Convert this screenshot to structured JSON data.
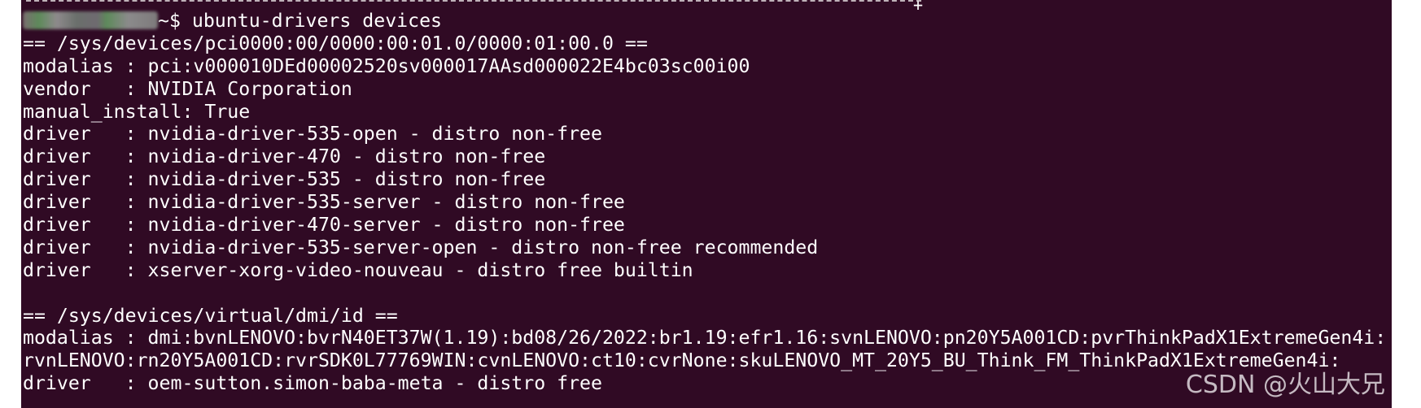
{
  "terminal": {
    "prompt_tail": "~$ ",
    "command": "ubuntu-drivers devices",
    "lines": [
      "== /sys/devices/pci0000:00/0000:00:01.0/0000:01:00.0 ==",
      "modalias : pci:v000010DEd00002520sv000017AAsd000022E4bc03sc00i00",
      "vendor   : NVIDIA Corporation",
      "manual_install: True",
      "driver   : nvidia-driver-535-open - distro non-free",
      "driver   : nvidia-driver-470 - distro non-free",
      "driver   : nvidia-driver-535 - distro non-free",
      "driver   : nvidia-driver-535-server - distro non-free",
      "driver   : nvidia-driver-470-server - distro non-free",
      "driver   : nvidia-driver-535-server-open - distro non-free recommended",
      "driver   : xserver-xorg-video-nouveau - distro free builtin",
      "",
      "== /sys/devices/virtual/dmi/id ==",
      "modalias : dmi:bvnLENOVO:bvrN40ET37W(1.19):bd08/26/2022:br1.19:efr1.16:svnLENOVO:pn20Y5A001CD:pvrThinkPadX1ExtremeGen4i:",
      "rvnLENOVO:rn20Y5A001CD:rvrSDK0L77769WIN:cvnLENOVO:ct10:cvrNone:skuLENOVO_MT_20Y5_BU_Think_FM_ThinkPadX1ExtremeGen4i:",
      "driver   : oem-sutton.simon-baba-meta - distro free"
    ]
  },
  "watermark": "CSDN @火山大兄",
  "colors": {
    "background": "#300a24",
    "text": "#ffffff"
  }
}
